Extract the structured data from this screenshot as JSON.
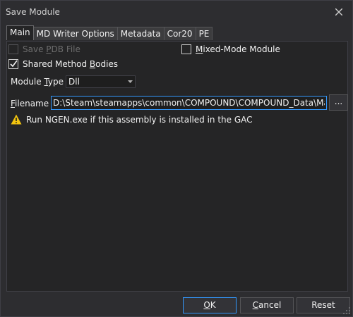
{
  "window": {
    "title": "Save Module"
  },
  "tabs": [
    {
      "label": "Main",
      "active": true
    },
    {
      "label": "MD Writer Options"
    },
    {
      "label": "Metadata"
    },
    {
      "label": "Cor20"
    },
    {
      "label": "PE"
    }
  ],
  "main": {
    "save_pdb": {
      "label_pre": "Save ",
      "label_u": "P",
      "label_post": "DB File",
      "checked": false,
      "enabled": false
    },
    "mixed_mode": {
      "label_pre": "",
      "label_u": "M",
      "label_post": "ixed-Mode Module",
      "checked": false
    },
    "shared_bodies": {
      "label_pre": "Shared Method ",
      "label_u": "B",
      "label_post": "odies",
      "checked": true
    },
    "module_type": {
      "label_pre": "Module ",
      "label_u": "T",
      "label_post": "ype",
      "value": "Dll"
    },
    "filename": {
      "label_pre": "",
      "label_u": "F",
      "label_post": "ilename",
      "value": "D:\\Steam\\steamapps\\common\\COMPOUND\\COMPOUND_Data\\Managed\\Assembly-CSharp.dll"
    },
    "browse_label": "...",
    "warning": "Run NGEN.exe if this assembly is installed in the GAC"
  },
  "buttons": {
    "ok": {
      "label_pre": "",
      "label_u": "O",
      "label_post": "K"
    },
    "cancel": {
      "label_pre": "",
      "label_u": "C",
      "label_post": "ancel"
    },
    "reset": "Reset"
  },
  "colors": {
    "accent": "#3399ff",
    "warning": "#f2c40f"
  }
}
